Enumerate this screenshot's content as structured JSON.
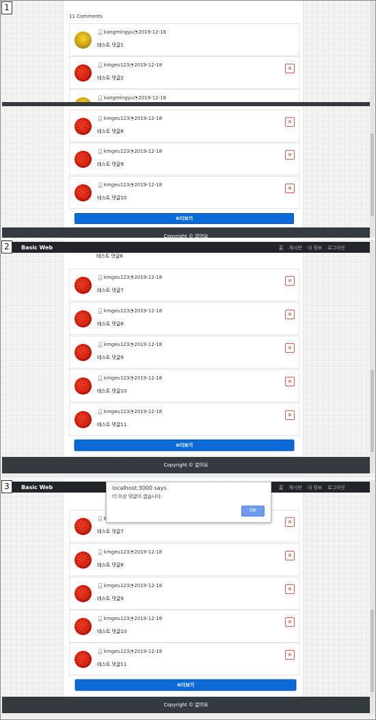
{
  "app": {
    "brand": "Basic Web",
    "nav": [
      "홈",
      "게시판",
      "내 정보",
      "로그아웃"
    ]
  },
  "panel_numbers": [
    "1",
    "2",
    "3"
  ],
  "comments_header": "11 Comments",
  "more_button": "더보기",
  "more_icon": "plus-circle-icon",
  "footer": "Copyright © 없어요",
  "delete_glyph": "×",
  "panel1": {
    "comments": [
      {
        "user": "kangmingyu",
        "date": "2019-12-18",
        "text": "테스트 댓글1",
        "avatar": "yellow",
        "deletable": false
      },
      {
        "user": "kmgeu123",
        "date": "2019-12-18",
        "text": "테스트 댓글2",
        "avatar": "red",
        "deletable": true
      },
      {
        "user": "kangmingyu",
        "date": "2019-12-18",
        "text": "",
        "avatar": "yellow",
        "deletable": false
      },
      {
        "user": "kmgeu123",
        "date": "2019-12-18",
        "text": "테스트 댓글8",
        "avatar": "red",
        "deletable": true
      },
      {
        "user": "kmgeu123",
        "date": "2019-12-18",
        "text": "테스트 댓글9",
        "avatar": "red",
        "deletable": true
      },
      {
        "user": "kmgeu123",
        "date": "2019-12-18",
        "text": "테스트 댓글10",
        "avatar": "red",
        "deletable": true
      }
    ]
  },
  "panel2": {
    "partial_text": "테스트 댓글6",
    "comments": [
      {
        "user": "kmgeu123",
        "date": "2019-12-18",
        "text": "테스트 댓글7",
        "avatar": "red",
        "deletable": true
      },
      {
        "user": "kmgeu123",
        "date": "2019-12-18",
        "text": "테스트 댓글8",
        "avatar": "red",
        "deletable": true
      },
      {
        "user": "kmgeu123",
        "date": "2019-12-18",
        "text": "테스트 댓글9",
        "avatar": "red",
        "deletable": true
      },
      {
        "user": "kmgeu123",
        "date": "2019-12-18",
        "text": "테스트 댓글10",
        "avatar": "red",
        "deletable": true
      },
      {
        "user": "kmgeu123",
        "date": "2019-12-18",
        "text": "테스트 댓글11",
        "avatar": "red",
        "deletable": true
      }
    ]
  },
  "panel3": {
    "comments": [
      {
        "user": "kmgeu123",
        "date": "",
        "text": "테스트 댓글7",
        "avatar": "red",
        "deletable": true
      },
      {
        "user": "kmgeu123",
        "date": "2019-12-18",
        "text": "테스트 댓글8",
        "avatar": "red",
        "deletable": true
      },
      {
        "user": "kmgeu123",
        "date": "2019-12-18",
        "text": "테스트 댓글9",
        "avatar": "red",
        "deletable": true
      },
      {
        "user": "kmgeu123",
        "date": "2019-12-18",
        "text": "테스트 댓글10",
        "avatar": "red",
        "deletable": true
      },
      {
        "user": "kmgeu123",
        "date": "2019-12-18",
        "text": "테스트 댓글11",
        "avatar": "red",
        "deletable": true
      }
    ],
    "dialog": {
      "title": "localhost:3000 says",
      "message": "더 이상 댓글이 없습니다.",
      "ok": "OK"
    }
  },
  "colors": {
    "primary": "#0b6ad8",
    "danger": "#d9534f",
    "footer_bg": "#343a40",
    "navbar_bg": "#212529"
  }
}
